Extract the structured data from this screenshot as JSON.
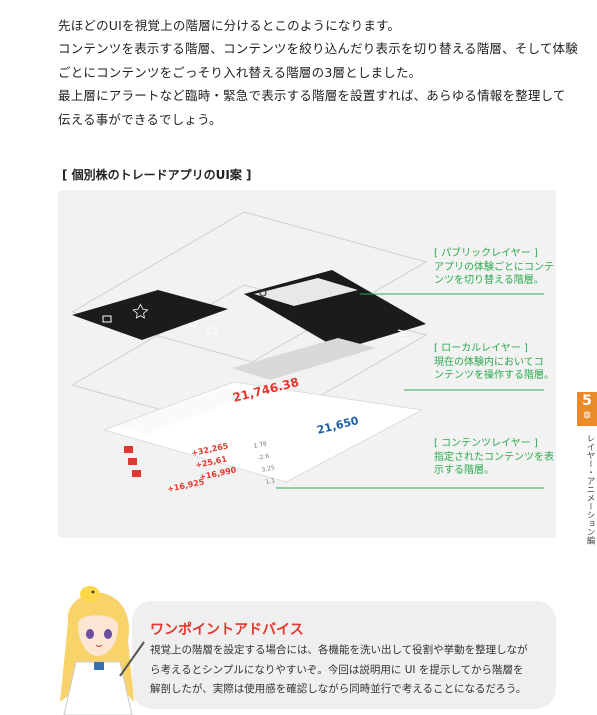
{
  "intro_lines": [
    "先ほどのUIを視覚上の階層に分けるとこのようになります。",
    "コンテンツを表示する階層、コンテンツを絞り込んだり表示を切り替える階層、そして体験",
    "ごとにコンテンツをごっそり入れ替える階層の3層としました。",
    "最上層にアラートなど臨時・緊急で表示する階層を設置すれば、あらゆる情報を整理して",
    "伝える事ができるでしょう。"
  ],
  "figure_caption": "[ 個別株のトレードアプリのUI案 ]",
  "annotations": [
    {
      "title": "[ パブリックレイヤー ]",
      "lines": [
        "アプリの体験ごとにコンテ",
        "ンツを切り替える階層。"
      ]
    },
    {
      "title": "[ ローカルレイヤー ]",
      "lines": [
        "現在の体験内においてコ",
        "ンテンツを操作する階層。"
      ]
    },
    {
      "title": "[ コンテンツレイヤー ]",
      "lines": [
        "指定されたコンテンツを表",
        "示する階層。"
      ]
    }
  ],
  "mockup": {
    "values": [
      "21,746.38",
      "21,650"
    ],
    "list": [
      {
        "price": "+32,265",
        "change": "1.78"
      },
      {
        "price": "+25,61",
        "change": "-2.6"
      },
      {
        "price": "+16,990",
        "change": "3.25"
      },
      {
        "price": "+16,925",
        "change": "1.1"
      }
    ]
  },
  "side_tab": {
    "number": "5",
    "chapter": "章"
  },
  "side_label": "レイヤー・アニメーション編",
  "advice": {
    "title": "ワンポイントアドバイス",
    "lines": [
      "視覚上の階層を設定する場合には、各機能を洗い出して役割や挙動を整理しなが",
      "ら考えるとシンプルになりやすいぞ。今回は説明用に UI を提示してから階層を",
      "解剖したが、実際は使用感を確認しながら同時並行で考えることになるだろう。"
    ]
  },
  "colors": {
    "accent_green": "#2aa94c",
    "tab_orange": "#e98a2b",
    "advice_red": "#e2372d",
    "mock_red": "#e2372d",
    "mock_blue": "#1f5fa8",
    "dark_bar": "#1b1b1b"
  },
  "icons": [
    "search-icon",
    "menu-icon",
    "star-icon",
    "chart-icon",
    "list-icon",
    "grid-icon"
  ]
}
